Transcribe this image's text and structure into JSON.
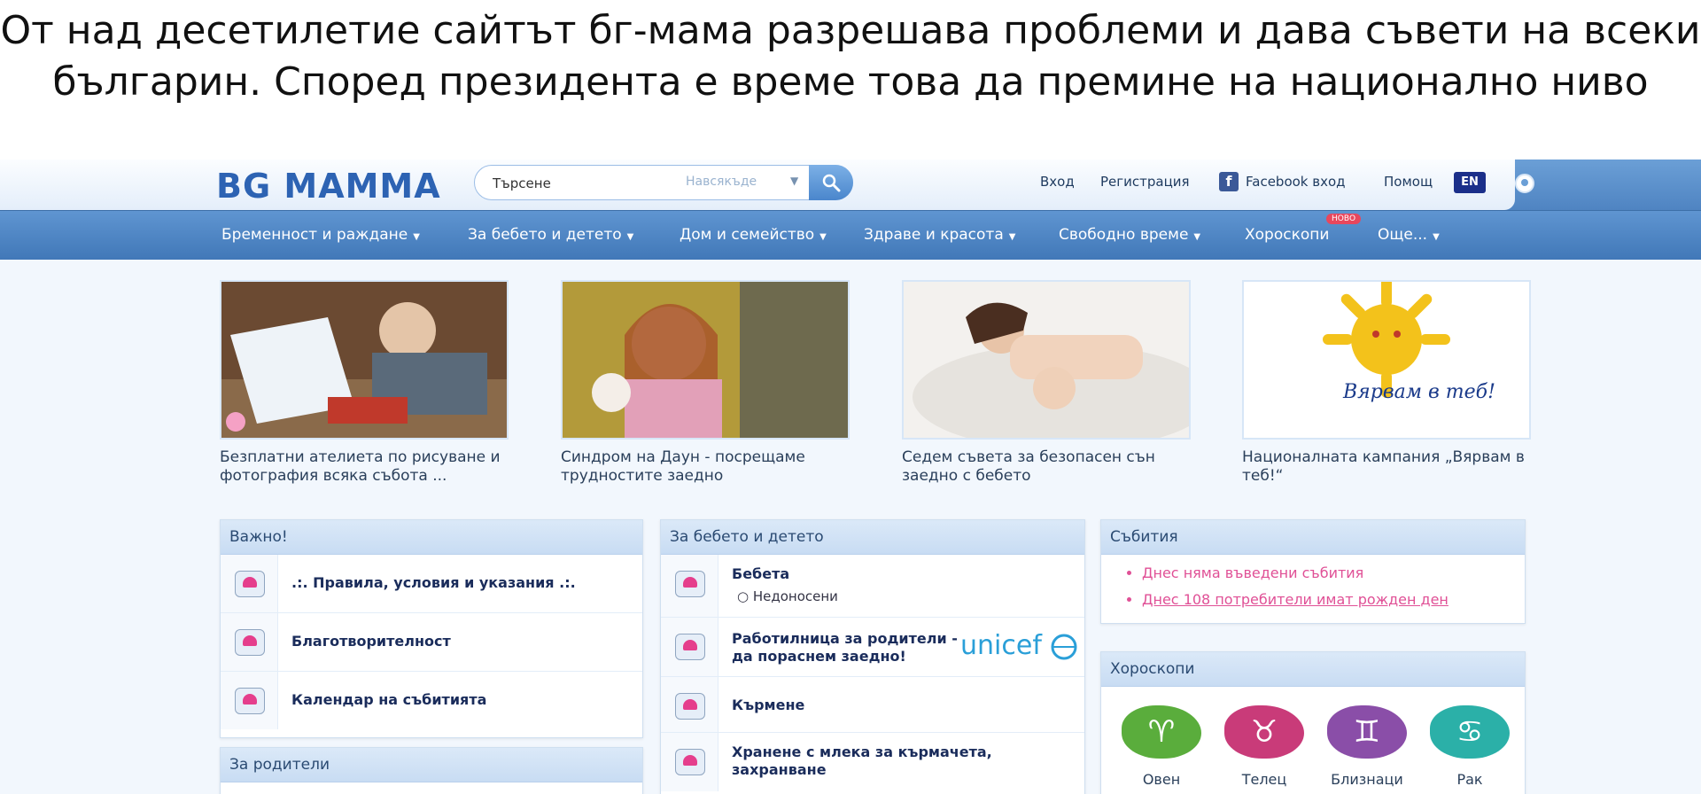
{
  "caption": {
    "line1": "От над десетилетие сайтът бг-мама разрешава проблеми и дава съвети на всеки",
    "line2": "българин. Според президента е време това да премине на национално ниво"
  },
  "header": {
    "logo": "BG MAMMA",
    "search_placeholder": "Търсене",
    "search_scope": "Навсякъде",
    "links": {
      "login": "Вход",
      "register": "Регистрация",
      "facebook": "Facebook вход",
      "help": "Помощ"
    },
    "lang": "EN"
  },
  "nav": {
    "items": [
      "Бременност и раждане",
      "За бебето и детето",
      "Дом и семейство",
      "Здраве и красота",
      "Свободно време",
      "Хороскопи",
      "Още..."
    ],
    "badge": "НОВО"
  },
  "features": [
    {
      "title": "Безплатни ателиета по рисуване и фотография всяка събота ..."
    },
    {
      "title": "Синдром на Даун - посрещаме трудностите заедно"
    },
    {
      "title": "Седем съвета за безопасен сън заедно с бебето"
    },
    {
      "title": "Националната кампания „Вярвам в теб!“",
      "logo_text": "Вярвам в теб!"
    }
  ],
  "panels": {
    "important": {
      "title": "Важно!",
      "rows": [
        ".:. Правила, условия и указания .:.",
        "Благотворителност",
        "Календар на събитията"
      ]
    },
    "parents": {
      "title": "За родители"
    },
    "baby": {
      "title": "За бебето и детето",
      "rows": [
        {
          "label": "Бебета",
          "sub": "Недоносени"
        },
        {
          "label": "Работилница за родители - да пораснем заедно!",
          "partner": "unicef"
        },
        {
          "label": "Кърмене"
        },
        {
          "label": "Хранене с млека за кърмачета, захранване"
        }
      ]
    },
    "events": {
      "title": "Събития",
      "items": [
        "Днес няма въведени събития",
        "Днес 108 потребители имат рожден ден"
      ]
    },
    "horoscopes": {
      "title": "Хороскопи",
      "signs": [
        {
          "name": "Овен",
          "glyph": "♈",
          "color": "#5aad3c"
        },
        {
          "name": "Телец",
          "glyph": "♉",
          "color": "#c93b79"
        },
        {
          "name": "Близнаци",
          "glyph": "♊",
          "color": "#8a4ea8"
        },
        {
          "name": "Рак",
          "glyph": "♋",
          "color": "#2bb0a8"
        }
      ]
    }
  }
}
